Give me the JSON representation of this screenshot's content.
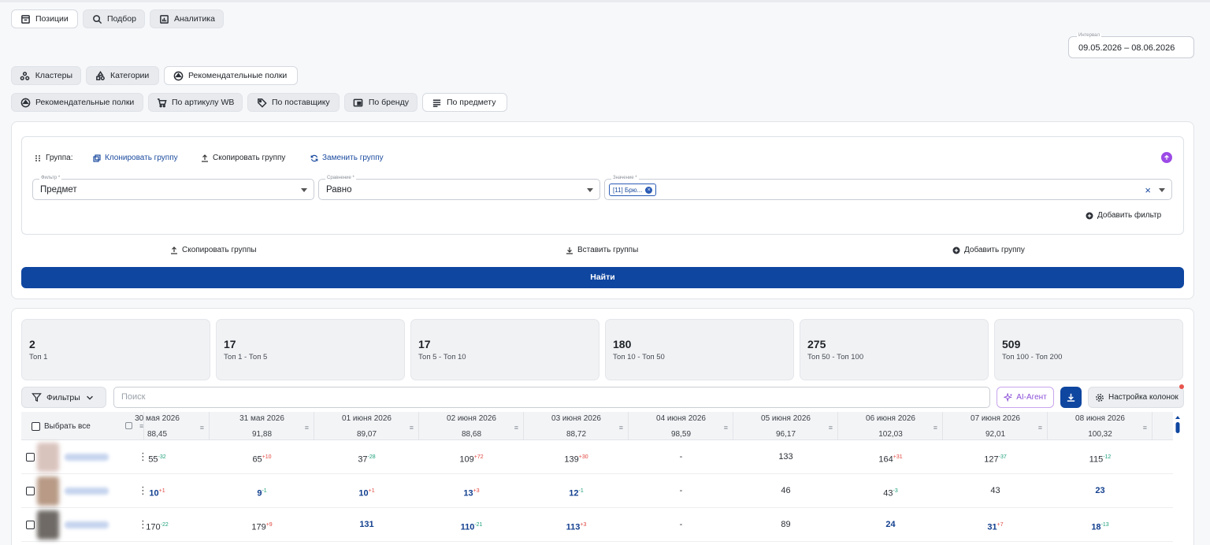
{
  "top_tabs": [
    {
      "label": "Позиции",
      "icon": "box-icon",
      "active": true
    },
    {
      "label": "Подбор",
      "icon": "search-icon",
      "active": false
    },
    {
      "label": "Аналитика",
      "icon": "chart-icon",
      "active": false
    }
  ],
  "interval": {
    "label": "Интервал",
    "value": "09.05.2026 – 08.06.2026"
  },
  "mode_tabs": [
    {
      "label": "Кластеры",
      "icon": "clusters-icon",
      "active": false
    },
    {
      "label": "Категории",
      "icon": "categories-icon",
      "active": false
    },
    {
      "label": "Рекомендательные полки",
      "icon": "shelf-icon",
      "active": true
    }
  ],
  "source_tabs": [
    {
      "label": "Рекомендательные полки",
      "icon": "shelf-icon",
      "active": false
    },
    {
      "label": "По артикулу WB",
      "icon": "cart-icon",
      "active": false
    },
    {
      "label": "По поставщику",
      "icon": "tag-icon",
      "active": false
    },
    {
      "label": "По бренду",
      "icon": "brand-icon",
      "active": false
    },
    {
      "label": "По предмету",
      "icon": "list-icon",
      "active": true
    }
  ],
  "group": {
    "title": "Группа:",
    "clone": "Клонировать группу",
    "copy": "Скопировать группу",
    "replace": "Заменить группу",
    "filter": {
      "label": "Фильтр *",
      "value": "Предмет"
    },
    "comparison": {
      "label": "Сравнение *",
      "value": "Равно"
    },
    "values": {
      "label": "Значение *",
      "tag": "[11] Брю..."
    },
    "add_filter": "Добавить фильтр"
  },
  "group_actions": {
    "copy_groups": "Скопировать группы",
    "paste_groups": "Вставить группы",
    "add_group": "Добавить группу"
  },
  "find_button": "Найти",
  "stats": [
    {
      "value": "2",
      "label": "Топ 1"
    },
    {
      "value": "17",
      "label": "Топ 1 - Топ 5"
    },
    {
      "value": "17",
      "label": "Топ 5 - Топ 10"
    },
    {
      "value": "180",
      "label": "Топ 10 - Топ 50"
    },
    {
      "value": "275",
      "label": "Топ 50 - Топ 100"
    },
    {
      "value": "509",
      "label": "Топ 100 - Топ 200"
    }
  ],
  "toolbar": {
    "filters": "Фильтры",
    "search_placeholder": "Поиск",
    "ai_agent": "AI-Агент",
    "columns_settings": "Настройка колонок"
  },
  "table": {
    "select_all": "Выбрать все",
    "columns": [
      {
        "date": "30 мая 2026",
        "avg": "88,45"
      },
      {
        "date": "31 мая 2026",
        "avg": "91,88"
      },
      {
        "date": "01 июня 2026",
        "avg": "89,07"
      },
      {
        "date": "02 июня 2026",
        "avg": "88,68"
      },
      {
        "date": "03 июня 2026",
        "avg": "88,72"
      },
      {
        "date": "04 июня 2026",
        "avg": "98,59"
      },
      {
        "date": "05 июня 2026",
        "avg": "96,17"
      },
      {
        "date": "06 июня 2026",
        "avg": "102,03"
      },
      {
        "date": "07 июня 2026",
        "avg": "92,01"
      },
      {
        "date": "08 июня 2026",
        "avg": "100,32"
      }
    ],
    "rows": [
      {
        "thumb": "#d9c3bd",
        "cells": [
          {
            "v": "55",
            "d": "-32",
            "b": false
          },
          {
            "v": "65",
            "d": "+10",
            "b": false
          },
          {
            "v": "37",
            "d": "-28",
            "b": false
          },
          {
            "v": "109",
            "d": "+72",
            "b": false
          },
          {
            "v": "139",
            "d": "+30",
            "b": false
          },
          {
            "v": "-",
            "d": "",
            "b": false
          },
          {
            "v": "133",
            "d": "",
            "b": false
          },
          {
            "v": "164",
            "d": "+31",
            "b": false
          },
          {
            "v": "127",
            "d": "-37",
            "b": false
          },
          {
            "v": "115",
            "d": "-12",
            "b": false
          }
        ]
      },
      {
        "thumb": "#b89a86",
        "cells": [
          {
            "v": "10",
            "d": "+1",
            "b": true
          },
          {
            "v": "9",
            "d": "-1",
            "b": true
          },
          {
            "v": "10",
            "d": "+1",
            "b": true
          },
          {
            "v": "13",
            "d": "+3",
            "b": true
          },
          {
            "v": "12",
            "d": "-1",
            "b": true
          },
          {
            "v": "-",
            "d": "",
            "b": false
          },
          {
            "v": "46",
            "d": "",
            "b": false
          },
          {
            "v": "43",
            "d": "-3",
            "b": false
          },
          {
            "v": "43",
            "d": "",
            "b": false
          },
          {
            "v": "23",
            "d": "",
            "b": true
          }
        ]
      },
      {
        "thumb": "#6f6a66",
        "cells": [
          {
            "v": "170",
            "d": "-22",
            "b": false
          },
          {
            "v": "179",
            "d": "+9",
            "b": false
          },
          {
            "v": "131",
            "d": "",
            "b": true
          },
          {
            "v": "110",
            "d": "-21",
            "b": true
          },
          {
            "v": "113",
            "d": "+3",
            "b": true
          },
          {
            "v": "-",
            "d": "",
            "b": false
          },
          {
            "v": "89",
            "d": "",
            "b": false
          },
          {
            "v": "24",
            "d": "",
            "b": true
          },
          {
            "v": "31",
            "d": "+7",
            "b": true
          },
          {
            "v": "18",
            "d": "-13",
            "b": true
          }
        ]
      }
    ]
  }
}
